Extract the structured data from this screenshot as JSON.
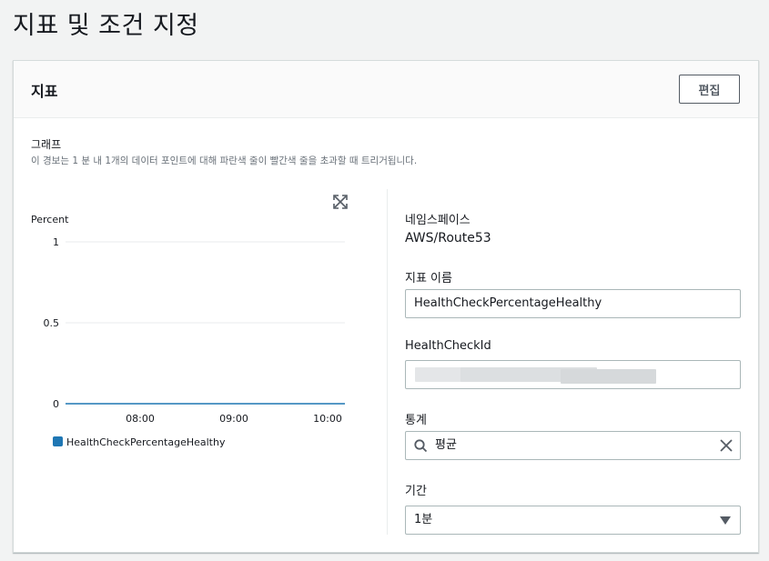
{
  "page_title": "지표 및 조건 지정",
  "panel": {
    "title": "지표",
    "edit_label": "편집"
  },
  "graph": {
    "title": "그래프",
    "description": "이 경보는 1 분 내 1개의 데이터 포인트에 대해 파란색 줄이 빨간색 줄을 초과할 때 트리거됩니다."
  },
  "chart_data": {
    "type": "line",
    "ylabel": "Percent",
    "y_ticks": [
      "1",
      "0.5",
      "0"
    ],
    "x_ticks": [
      "08:00",
      "09:00",
      "10:00"
    ],
    "ylim": [
      0,
      1
    ],
    "series": [
      {
        "name": "HealthCheckPercentageHealthy",
        "color": "#1f77b4",
        "values": [
          0,
          0
        ]
      }
    ],
    "grid": true,
    "legend_position": "bottom-left"
  },
  "form": {
    "namespace_label": "네임스페이스",
    "namespace_value": "AWS/Route53",
    "metric_name_label": "지표 이름",
    "metric_name_value": "HealthCheckPercentageHealthy",
    "health_check_id_label": "HealthCheckId",
    "statistic_label": "통계",
    "statistic_value": "평균",
    "period_label": "기간",
    "period_value": "1분"
  },
  "icons": {
    "expand": "expand-icon",
    "search": "search-icon",
    "clear": "close-icon",
    "dropdown": "caret-down-icon"
  }
}
